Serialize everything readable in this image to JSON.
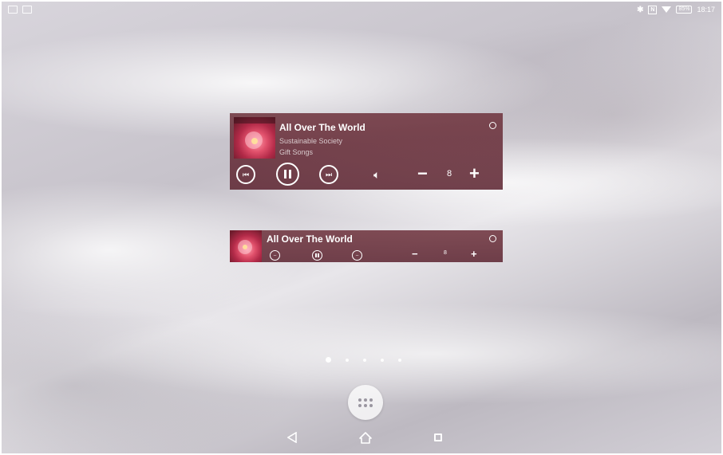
{
  "status_bar": {
    "time": "18:17",
    "battery": "85%"
  },
  "widget_large": {
    "title": "All Over The World",
    "artist": "Sustainable Society",
    "album": "Gift Songs",
    "volume": "8",
    "minus_label": "−",
    "plus_label": "+"
  },
  "widget_small": {
    "title": "All Over The World",
    "volume": "8",
    "minus_label": "−",
    "plus_label": "+"
  },
  "home": {
    "page_count": 5,
    "active_page": 1
  },
  "colors": {
    "widget_bg": "#6e323c",
    "accent": "#ffffff"
  }
}
